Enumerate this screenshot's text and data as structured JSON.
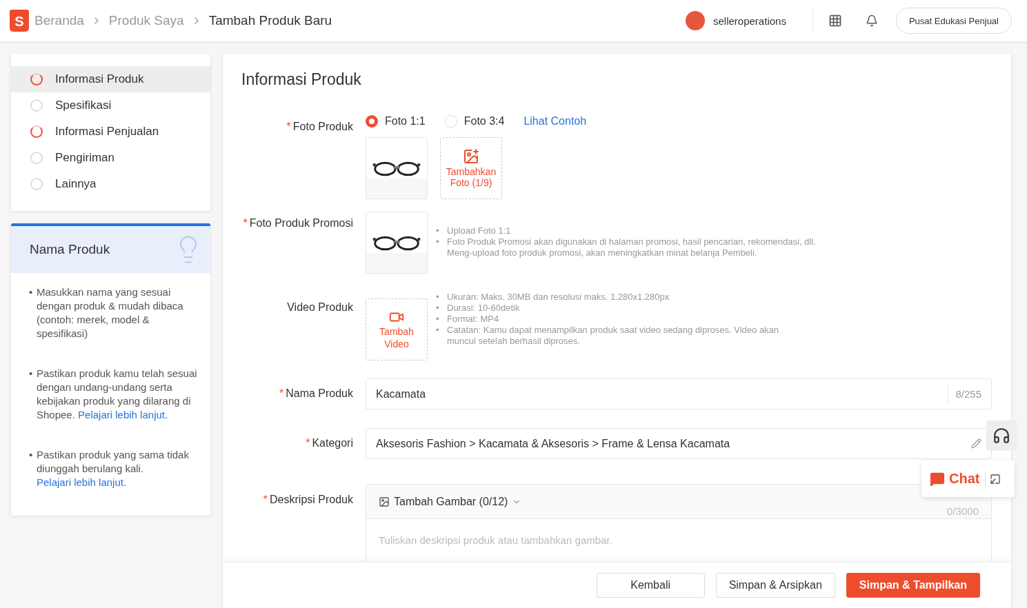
{
  "header": {
    "logo_letter": "S",
    "breadcrumbs": [
      {
        "label": "Beranda",
        "current": false
      },
      {
        "label": "Produk Saya",
        "current": false
      },
      {
        "label": "Tambah Produk Baru",
        "current": true
      }
    ],
    "username": "selleroperations",
    "education_button": "Pusat Edukasi Penjual"
  },
  "steps": [
    {
      "label": "Informasi Produk",
      "selected": true,
      "in_progress": true
    },
    {
      "label": "Spesifikasi",
      "selected": false,
      "in_progress": false
    },
    {
      "label": "Informasi Penjualan",
      "selected": false,
      "in_progress": true
    },
    {
      "label": "Pengiriman",
      "selected": false,
      "in_progress": false
    },
    {
      "label": "Lainnya",
      "selected": false,
      "in_progress": false
    }
  ],
  "tips": {
    "title": "Nama Produk",
    "bullet": "•",
    "items": [
      {
        "text": "Masukkan nama yang sesuai dengan produk & mudah dibaca (contoh: merek, model & spesifikasi)"
      },
      {
        "text": "Pastikan produk kamu telah sesuai dengan undang-undang serta kebijakan produk yang dilarang di Shopee.",
        "link": "Pelajari lebih lanjut",
        "after": "."
      },
      {
        "text": "Pastikan produk yang sama tidak diunggah berulang kali.",
        "link": "Pelajari lebih lanjut",
        "after": "."
      }
    ]
  },
  "form": {
    "title": "Informasi Produk",
    "photo": {
      "label": "Foto Produk",
      "required_mark": "*",
      "ratios": [
        {
          "label": "Foto 1:1",
          "selected": true
        },
        {
          "label": "Foto 3:4",
          "selected": false
        }
      ],
      "example_link": "Lihat Contoh",
      "add_button": "Tambahkan Foto (1/9)"
    },
    "promo_photo": {
      "label": "Foto Produk Promosi",
      "required_mark": "*",
      "bullet": "•",
      "notes": [
        "Upload Foto 1:1",
        "Foto Produk Promosi akan digunakan di halaman promosi, hasil pencarian, rekomendasi, dll. Meng-upload foto produk promosi, akan meningkatkan minat belanja Pembeli."
      ]
    },
    "video": {
      "label": "Video Produk",
      "add_button": "Tambah Video",
      "bullet": "•",
      "notes": [
        "Ukuran: Maks. 30MB dan resolusi maks. 1.280x1.280px",
        "Durasi: 10-60detik",
        "Format: MP4",
        "Catatan: Kamu dapat menampilkan produk saat video sedang diproses. Video akan muncul setelah berhasil diproses."
      ]
    },
    "name": {
      "label": "Nama Produk",
      "required_mark": "*",
      "value": "Kacamata",
      "counter": "8/255"
    },
    "category": {
      "label": "Kategori",
      "required_mark": "*",
      "value": "Aksesoris Fashion > Kacamata & Aksesoris > Frame & Lensa Kacamata"
    },
    "description": {
      "label": "Deskripsi Produk",
      "required_mark": "*",
      "add_image": "Tambah Gambar (0/12)",
      "counter": "0/3000",
      "placeholder": "Tuliskan deskripsi produk atau tambahkan gambar."
    }
  },
  "footer": {
    "buttons": [
      {
        "label": "Kembali",
        "kind": "plain"
      },
      {
        "label": "Simpan & Arsipkan",
        "kind": "plain"
      },
      {
        "label": "Simpan & Tampilkan",
        "kind": "primary"
      }
    ]
  },
  "chat": {
    "label": "Chat"
  }
}
